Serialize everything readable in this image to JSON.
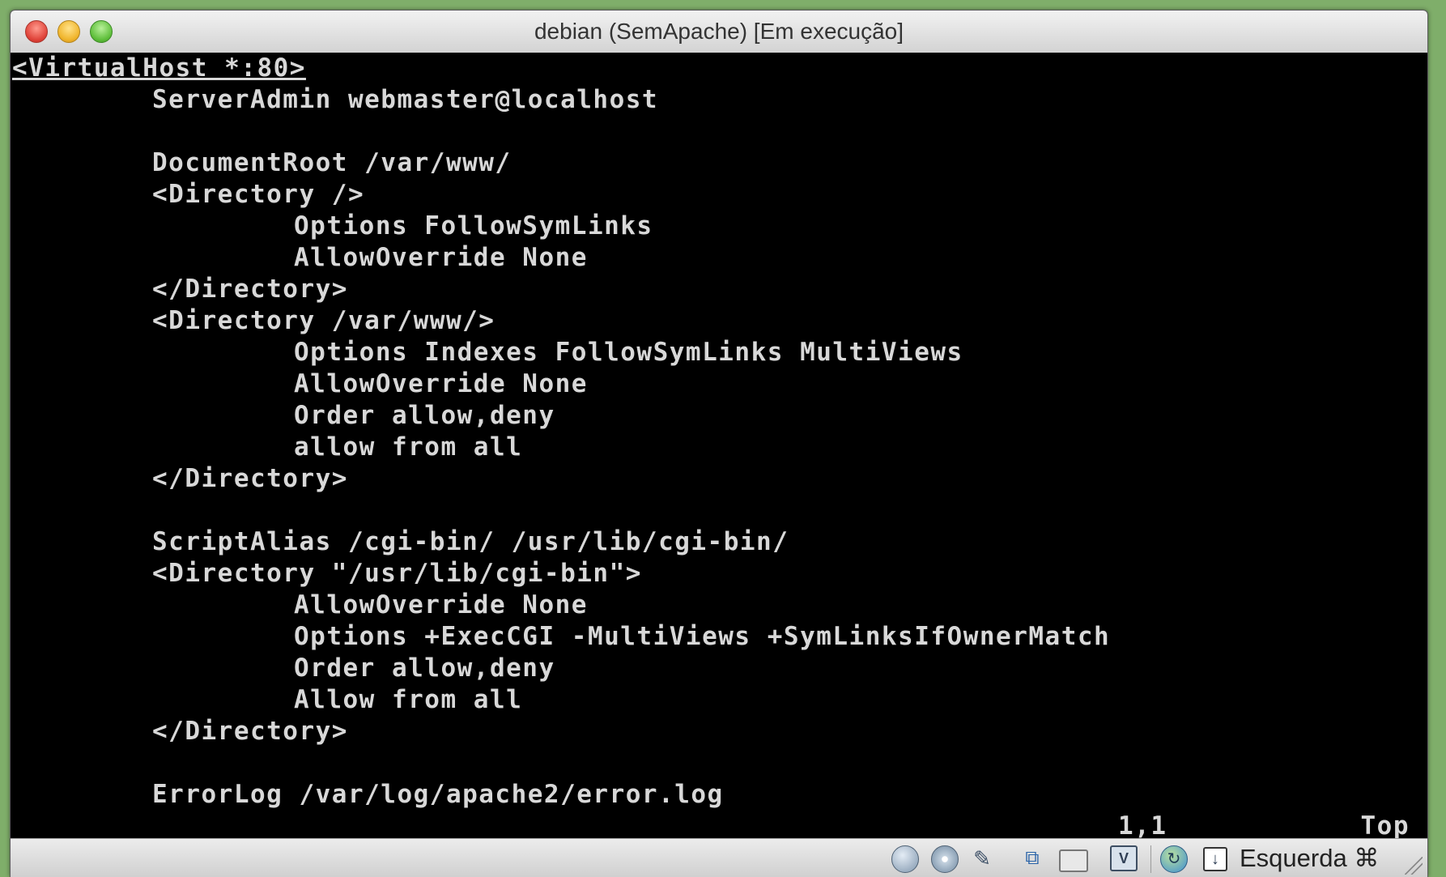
{
  "window": {
    "title": "debian (SemApache) [Em execução]"
  },
  "terminal": {
    "lines": [
      "<VirtualHost *:80>",
      "ServerAdmin webmaster@localhost",
      "DocumentRoot /var/www/",
      "<Directory />",
      "Options FollowSymLinks",
      "AllowOverride None",
      "</Directory>",
      "<Directory /var/www/>",
      "Options Indexes FollowSymLinks MultiViews",
      "AllowOverride None",
      "Order allow,deny",
      "allow from all",
      "</Directory>",
      "ScriptAlias /cgi-bin/ /usr/lib/cgi-bin/",
      "<Directory \"/usr/lib/cgi-bin\">",
      "AllowOverride None",
      "Options +ExecCGI -MultiViews +SymLinksIfOwnerMatch",
      "Order allow,deny",
      "Allow from all",
      "</Directory>",
      "ErrorLog /var/log/apache2/error.log"
    ],
    "status_position": "1,1",
    "status_scroll": "Top"
  },
  "statusbar": {
    "icons": [
      "hard-disk-icon",
      "optical-drive-icon",
      "usb-icon",
      "network-icon",
      "shared-folders-icon",
      "vm-chip-icon",
      "globe-icon",
      "host-key-icon"
    ],
    "host_key_label": "Esquerda ⌘"
  }
}
